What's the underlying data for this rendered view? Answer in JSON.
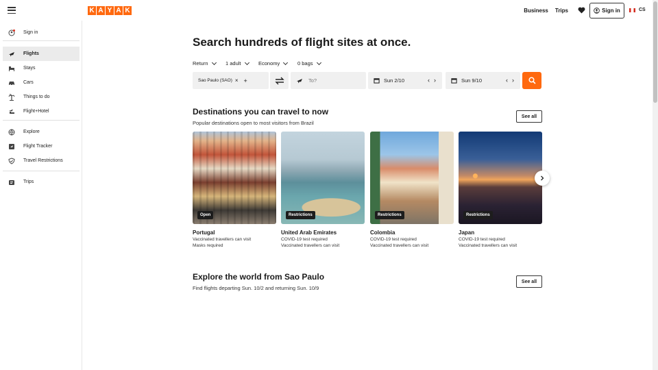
{
  "brand": {
    "letters": [
      "K",
      "A",
      "Y",
      "A",
      "K"
    ],
    "accent": "#ff690f"
  },
  "header": {
    "business": "Business",
    "trips": "Trips",
    "sign_in": "Sign in",
    "locale": "CS"
  },
  "sidebar": {
    "sign_in": "Sign in",
    "items": [
      {
        "label": "Flights",
        "icon": "plane-icon",
        "active": true
      },
      {
        "label": "Stays",
        "icon": "bed-icon"
      },
      {
        "label": "Cars",
        "icon": "car-icon"
      },
      {
        "label": "Things to do",
        "icon": "palm-icon"
      },
      {
        "label": "Flight+Hotel",
        "icon": "flight-hotel-icon"
      },
      {
        "label": "Explore",
        "icon": "globe-icon"
      },
      {
        "label": "Flight Tracker",
        "icon": "tracker-icon"
      },
      {
        "label": "Travel Restrictions",
        "icon": "shield-icon"
      },
      {
        "label": "Trips",
        "icon": "trips-icon"
      }
    ]
  },
  "search": {
    "headline": "Search hundreds of flight sites at once.",
    "trip_type": "Return",
    "travelers": "1 adult",
    "cabin": "Economy",
    "bags": "0 bags",
    "origin": "Sao Paulo (SAO)",
    "destination_placeholder": "To?",
    "depart_date": "Sun 2/10",
    "return_date": "Sun 9/10"
  },
  "destinations": {
    "title": "Destinations you can travel to now",
    "subtitle": "Popular destinations open to most visitors from Brazil",
    "see_all": "See all",
    "cards": [
      {
        "name": "Portugal",
        "badge": "Open",
        "lines": [
          "Vaccinated travellers can visit",
          "Masks required"
        ]
      },
      {
        "name": "United Arab Emirates",
        "badge": "Restrictions",
        "lines": [
          "COVID-19 test required",
          "Vaccinated travellers can visit"
        ]
      },
      {
        "name": "Colombia",
        "badge": "Restrictions",
        "lines": [
          "COVID-19 test required",
          "Vaccinated travellers can visit"
        ]
      },
      {
        "name": "Japan",
        "badge": "Restrictions",
        "lines": [
          "COVID-19 test required",
          "Vaccinated travellers can visit"
        ]
      }
    ]
  },
  "explore": {
    "title": "Explore the world from Sao Paulo",
    "subtitle": "Find flights departing Sun. 10/2 and returning Sun. 10/9",
    "see_all": "See all"
  }
}
